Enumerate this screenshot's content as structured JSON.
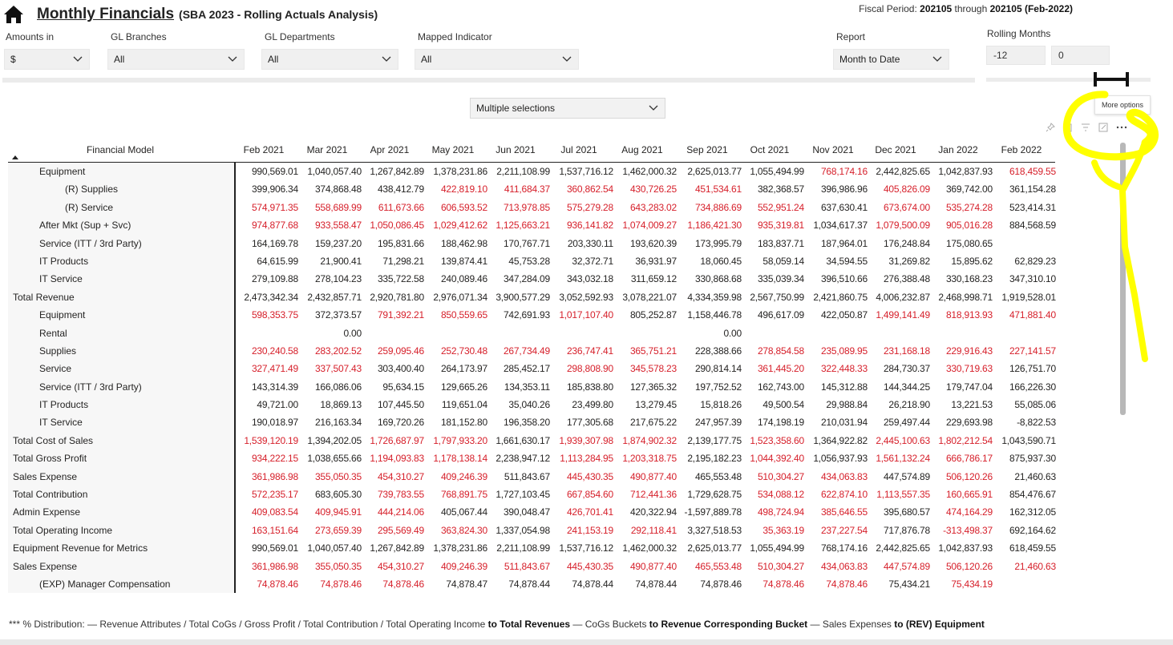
{
  "header": {
    "title": "Monthly Financials",
    "subtitle": "(SBA 2023 - Rolling Actuals Analysis)",
    "fiscal_prefix": "Fiscal Period:",
    "fiscal_from": "202105",
    "fiscal_through": "through",
    "fiscal_to": "202105 (Feb-2022)"
  },
  "slicers": {
    "amounts_label": "Amounts in",
    "amounts_value": "$",
    "branches_label": "GL Branches",
    "branches_value": "All",
    "departments_label": "GL Departments",
    "departments_value": "All",
    "mapped_label": "Mapped Indicator",
    "mapped_value": "All",
    "report_label": "Report",
    "report_value": "Month to Date",
    "rolling_label": "Rolling Months",
    "rolling_min": "-12",
    "rolling_max": "0",
    "multi_value": "Multiple selections"
  },
  "tooltip": "More options",
  "table": {
    "first_header": "Financial Model",
    "columns": [
      "Feb 2021",
      "Mar 2021",
      "Apr 2021",
      "May 2021",
      "Jun 2021",
      "Jul 2021",
      "Aug 2021",
      "Sep 2021",
      "Oct 2021",
      "Nov 2021",
      "Dec 2021",
      "Jan 2022",
      "Feb 2022"
    ],
    "rows": [
      {
        "label": "Equipment",
        "indent": 1,
        "values": [
          "990,569.01",
          "1,040,057.40",
          "1,267,842.89",
          "1,378,231.86",
          "2,211,108.99",
          "1,537,716.12",
          "1,462,000.32",
          "2,625,013.77",
          "1,055,494.99",
          "768,174.16",
          "2,442,825.65",
          "1,042,837.93",
          "618,459.55"
        ],
        "neg": [
          0,
          0,
          0,
          0,
          0,
          0,
          0,
          0,
          0,
          1,
          0,
          0,
          1
        ]
      },
      {
        "label": "(R) Supplies",
        "indent": 2,
        "values": [
          "399,906.34",
          "374,868.48",
          "438,412.79",
          "422,819.10",
          "411,684.37",
          "360,862.54",
          "430,726.25",
          "451,534.61",
          "382,368.57",
          "396,986.96",
          "405,826.09",
          "369,742.00",
          "361,154.28"
        ],
        "neg": [
          0,
          0,
          0,
          1,
          1,
          1,
          1,
          1,
          0,
          0,
          1,
          0,
          0
        ]
      },
      {
        "label": "(R) Service",
        "indent": 2,
        "values": [
          "574,971.35",
          "558,689.99",
          "611,673.66",
          "606,593.52",
          "713,978.85",
          "575,279.28",
          "643,283.02",
          "734,886.69",
          "552,951.24",
          "637,630.41",
          "673,674.00",
          "535,274.28",
          "523,414.31"
        ],
        "neg": [
          1,
          1,
          1,
          1,
          1,
          1,
          1,
          1,
          1,
          0,
          1,
          1,
          0
        ]
      },
      {
        "label": "After Mkt (Sup + Svc)",
        "indent": 1,
        "values": [
          "974,877.68",
          "933,558.47",
          "1,050,086.45",
          "1,029,412.62",
          "1,125,663.21",
          "936,141.82",
          "1,074,009.27",
          "1,186,421.30",
          "935,319.81",
          "1,034,617.37",
          "1,079,500.09",
          "905,016.28",
          "884,568.59"
        ],
        "neg": [
          1,
          1,
          1,
          1,
          1,
          1,
          1,
          1,
          1,
          0,
          1,
          1,
          0
        ]
      },
      {
        "label": "Service (ITT / 3rd Party)",
        "indent": 1,
        "values": [
          "164,169.78",
          "159,237.20",
          "195,831.66",
          "188,462.98",
          "170,767.71",
          "203,330.11",
          "193,620.39",
          "173,995.79",
          "183,837.71",
          "187,964.01",
          "176,248.84",
          "175,080.65",
          ""
        ],
        "neg": [
          0,
          0,
          0,
          0,
          0,
          0,
          0,
          0,
          0,
          0,
          0,
          0,
          0
        ]
      },
      {
        "label": "IT Products",
        "indent": 1,
        "values": [
          "64,615.99",
          "21,900.41",
          "71,298.21",
          "139,874.41",
          "45,753.28",
          "32,372.71",
          "36,931.97",
          "18,060.45",
          "58,059.14",
          "34,594.55",
          "31,269.82",
          "15,895.62",
          "62,829.23"
        ],
        "neg": [
          0,
          0,
          0,
          0,
          0,
          0,
          0,
          0,
          0,
          0,
          0,
          0,
          0
        ]
      },
      {
        "label": "IT Service",
        "indent": 1,
        "values": [
          "279,109.88",
          "278,104.23",
          "335,722.58",
          "240,089.46",
          "347,284.09",
          "343,032.18",
          "311,659.12",
          "330,868.68",
          "335,039.34",
          "396,510.66",
          "276,388.48",
          "330,168.23",
          "347,310.10"
        ],
        "neg": [
          0,
          0,
          0,
          0,
          0,
          0,
          0,
          0,
          0,
          0,
          0,
          0,
          0
        ]
      },
      {
        "label": "Total Revenue",
        "indent": 0,
        "values": [
          "2,473,342.34",
          "2,432,857.71",
          "2,920,781.80",
          "2,976,071.34",
          "3,900,577.29",
          "3,052,592.93",
          "3,078,221.07",
          "4,334,359.98",
          "2,567,750.99",
          "2,421,860.75",
          "4,006,232.87",
          "2,468,998.71",
          "1,919,528.01"
        ],
        "neg": [
          0,
          0,
          0,
          0,
          0,
          0,
          0,
          0,
          0,
          0,
          0,
          0,
          0
        ]
      },
      {
        "label": "Equipment",
        "indent": 1,
        "values": [
          "598,353.75",
          "372,373.57",
          "791,392.21",
          "850,559.65",
          "742,691.93",
          "1,017,107.40",
          "805,252.87",
          "1,158,446.78",
          "496,617.09",
          "422,050.87",
          "1,499,141.49",
          "818,913.93",
          "471,881.40"
        ],
        "neg": [
          1,
          0,
          1,
          1,
          0,
          1,
          0,
          0,
          0,
          0,
          1,
          1,
          1
        ]
      },
      {
        "label": "Rental",
        "indent": 1,
        "values": [
          "",
          "0.00",
          "",
          "",
          "",
          "",
          "",
          "0.00",
          "",
          "",
          "",
          "",
          ""
        ],
        "neg": [
          0,
          0,
          0,
          0,
          0,
          0,
          0,
          0,
          0,
          0,
          0,
          0,
          0
        ]
      },
      {
        "label": "Supplies",
        "indent": 1,
        "values": [
          "230,240.58",
          "283,202.52",
          "259,095.46",
          "252,730.48",
          "267,734.49",
          "236,747.41",
          "365,751.21",
          "228,388.66",
          "278,854.58",
          "235,089.95",
          "231,168.18",
          "229,916.43",
          "227,141.57"
        ],
        "neg": [
          1,
          1,
          1,
          1,
          1,
          1,
          1,
          0,
          1,
          1,
          1,
          1,
          1
        ]
      },
      {
        "label": "Service",
        "indent": 1,
        "values": [
          "327,471.49",
          "337,507.43",
          "303,400.40",
          "264,173.97",
          "285,452.17",
          "298,808.90",
          "345,578.23",
          "290,814.14",
          "361,445.20",
          "322,448.33",
          "284,730.37",
          "330,719.63",
          "126,751.70"
        ],
        "neg": [
          1,
          1,
          0,
          0,
          0,
          1,
          1,
          0,
          1,
          1,
          0,
          1,
          0
        ]
      },
      {
        "label": "Service (ITT / 3rd Party)",
        "indent": 1,
        "values": [
          "143,314.39",
          "166,086.06",
          "95,634.15",
          "129,665.26",
          "134,353.11",
          "185,838.80",
          "127,365.32",
          "197,752.52",
          "162,743.00",
          "145,312.88",
          "144,344.25",
          "179,747.04",
          "166,226.30"
        ],
        "neg": [
          0,
          0,
          0,
          0,
          0,
          0,
          0,
          0,
          0,
          0,
          0,
          0,
          0
        ]
      },
      {
        "label": "IT Products",
        "indent": 1,
        "values": [
          "49,721.00",
          "18,869.13",
          "107,445.50",
          "119,651.04",
          "35,040.26",
          "23,499.80",
          "13,279.45",
          "15,818.26",
          "49,500.54",
          "29,988.84",
          "26,218.90",
          "13,221.53",
          "55,085.06"
        ],
        "neg": [
          0,
          0,
          0,
          0,
          0,
          0,
          0,
          0,
          0,
          0,
          0,
          0,
          0
        ]
      },
      {
        "label": "IT Service",
        "indent": 1,
        "values": [
          "190,018.97",
          "216,163.34",
          "169,720.26",
          "181,152.80",
          "196,358.20",
          "177,305.68",
          "217,675.22",
          "247,957.39",
          "174,198.19",
          "210,031.94",
          "259,497.44",
          "229,693.98",
          "-8,822.53"
        ],
        "neg": [
          0,
          0,
          0,
          0,
          0,
          0,
          0,
          0,
          0,
          0,
          0,
          0,
          0
        ]
      },
      {
        "label": "Total Cost of Sales",
        "indent": 0,
        "values": [
          "1,539,120.19",
          "1,394,202.05",
          "1,726,687.97",
          "1,797,933.20",
          "1,661,630.17",
          "1,939,307.98",
          "1,874,902.32",
          "2,139,177.75",
          "1,523,358.60",
          "1,364,922.82",
          "2,445,100.63",
          "1,802,212.54",
          "1,043,590.71"
        ],
        "neg": [
          1,
          0,
          1,
          1,
          0,
          1,
          1,
          0,
          1,
          0,
          1,
          1,
          0
        ]
      },
      {
        "label": "Total Gross Profit",
        "indent": 0,
        "values": [
          "934,222.15",
          "1,038,655.66",
          "1,194,093.83",
          "1,178,138.14",
          "2,238,947.12",
          "1,113,284.95",
          "1,203,318.75",
          "2,195,182.23",
          "1,044,392.40",
          "1,056,937.93",
          "1,561,132.24",
          "666,786.17",
          "875,937.30"
        ],
        "neg": [
          1,
          0,
          1,
          1,
          0,
          1,
          1,
          0,
          1,
          0,
          1,
          1,
          0
        ]
      },
      {
        "label": "Sales Expense",
        "indent": 0,
        "values": [
          "361,986.98",
          "355,050.35",
          "454,310.27",
          "409,246.39",
          "511,843.67",
          "445,430.35",
          "490,877.40",
          "465,553.48",
          "510,304.27",
          "434,063.83",
          "447,574.89",
          "506,120.26",
          "21,460.63"
        ],
        "neg": [
          1,
          1,
          1,
          1,
          0,
          1,
          1,
          0,
          1,
          1,
          0,
          1,
          0
        ]
      },
      {
        "label": "Total Contribution",
        "indent": 0,
        "values": [
          "572,235.17",
          "683,605.30",
          "739,783.55",
          "768,891.75",
          "1,727,103.45",
          "667,854.60",
          "712,441.36",
          "1,729,628.75",
          "534,088.12",
          "622,874.10",
          "1,113,557.35",
          "160,665.91",
          "854,476.67"
        ],
        "neg": [
          1,
          0,
          1,
          1,
          0,
          1,
          1,
          0,
          1,
          1,
          1,
          1,
          0
        ]
      },
      {
        "label": "Admin Expense",
        "indent": 0,
        "values": [
          "409,083.54",
          "409,945.91",
          "444,214.06",
          "405,067.44",
          "390,048.47",
          "426,701.41",
          "420,322.94",
          "-1,597,889.78",
          "498,724.94",
          "385,646.55",
          "395,680.57",
          "474,164.29",
          "162,312.05"
        ],
        "neg": [
          1,
          1,
          1,
          0,
          0,
          1,
          0,
          0,
          1,
          1,
          0,
          1,
          0
        ]
      },
      {
        "label": "Total Operating Income",
        "indent": 0,
        "values": [
          "163,151.64",
          "273,659.39",
          "295,569.49",
          "363,824.30",
          "1,337,054.98",
          "241,153.19",
          "292,118.41",
          "3,327,518.53",
          "35,363.19",
          "237,227.54",
          "717,876.78",
          "-313,498.37",
          "692,164.62"
        ],
        "neg": [
          1,
          1,
          1,
          1,
          0,
          1,
          1,
          0,
          1,
          1,
          0,
          1,
          0
        ]
      },
      {
        "label": "Equipment Revenue for Metrics",
        "indent": 0,
        "values": [
          "990,569.01",
          "1,040,057.40",
          "1,267,842.89",
          "1,378,231.86",
          "2,211,108.99",
          "1,537,716.12",
          "1,462,000.32",
          "2,625,013.77",
          "1,055,494.99",
          "768,174.16",
          "2,442,825.65",
          "1,042,837.93",
          "618,459.55"
        ],
        "neg": [
          0,
          0,
          0,
          0,
          0,
          0,
          0,
          0,
          0,
          0,
          0,
          0,
          0
        ]
      },
      {
        "label": "Sales Expense",
        "indent": 0,
        "values": [
          "361,986.98",
          "355,050.35",
          "454,310.27",
          "409,246.39",
          "511,843.67",
          "445,430.35",
          "490,877.40",
          "465,553.48",
          "510,304.27",
          "434,063.83",
          "447,574.89",
          "506,120.26",
          "21,460.63"
        ],
        "neg": [
          1,
          1,
          1,
          1,
          1,
          1,
          1,
          1,
          1,
          1,
          1,
          1,
          1
        ]
      },
      {
        "label": "(EXP) Manager Compensation",
        "indent": 1,
        "values": [
          "74,878.46",
          "74,878.46",
          "74,878.46",
          "74,878.47",
          "74,878.44",
          "74,878.44",
          "74,878.44",
          "74,878.46",
          "74,878.46",
          "74,878.46",
          "75,434.21",
          "75,434.19",
          ""
        ],
        "neg": [
          1,
          1,
          1,
          0,
          0,
          0,
          0,
          0,
          1,
          1,
          0,
          1,
          0
        ]
      }
    ]
  },
  "footnote": {
    "p1": "*** % Distribution: — Revenue Attributes / Total CoGs / Gross Profit / Total Contribution / Total Operating Income ",
    "b1": "to Total Revenues",
    "p2": "  — CoGs Buckets ",
    "b2": "to Revenue Corresponding Bucket",
    "p3": "  — Sales Expenses ",
    "b3": "to (REV) Equipment"
  },
  "colors": {
    "negative": "#d61f2a",
    "text": "#252423",
    "annotation": "#ffff00"
  },
  "icons": [
    "home-icon",
    "chevron-down-icon",
    "pin-icon",
    "copy-icon",
    "filter-icon",
    "focus-icon",
    "more-options-icon",
    "sort-up-icon"
  ]
}
